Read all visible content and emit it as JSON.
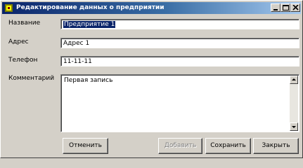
{
  "window": {
    "title": "Редактирование данных о предприятии"
  },
  "form": {
    "name": {
      "label": "Название",
      "value": "Предприятие 1"
    },
    "address": {
      "label": "Адрес",
      "value": "Адрес 1"
    },
    "phone": {
      "label": "Телефон",
      "value": "11-11-11"
    },
    "comment": {
      "label": "Комментарий",
      "value": "Первая запись"
    }
  },
  "buttons": {
    "cancel": "Отменить",
    "add": "Добавить",
    "save": "Сохранить",
    "close": "Закрыть"
  },
  "colors": {
    "title_bar_start": "#0a246a",
    "title_bar_end": "#a6caf0",
    "face": "#d4d0c8"
  },
  "icons": [
    "app-icon",
    "minimize-icon",
    "maximize-icon",
    "close-icon",
    "scroll-up-icon",
    "scroll-down-icon"
  ]
}
